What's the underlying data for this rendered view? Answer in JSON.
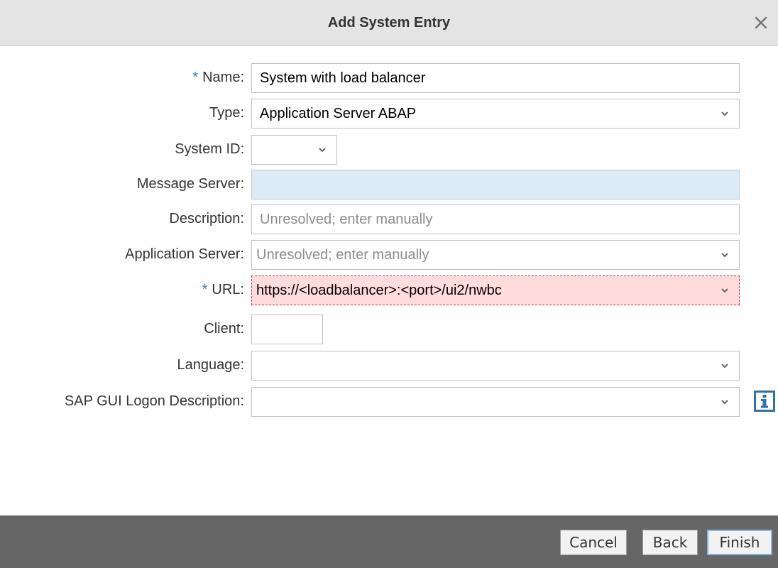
{
  "dialog": {
    "title": "Add System Entry"
  },
  "form": {
    "name": {
      "label": "Name:",
      "required_marker": "*",
      "value": "System with load balancer"
    },
    "type": {
      "label": "Type:",
      "value": "Application Server ABAP"
    },
    "system_id": {
      "label": "System ID:",
      "value": ""
    },
    "message_server": {
      "label": "Message Server:",
      "value": ""
    },
    "description": {
      "label": "Description:",
      "placeholder": "Unresolved; enter manually"
    },
    "application_server": {
      "label": "Application Server:",
      "placeholder": "Unresolved; enter manually"
    },
    "url": {
      "label": "URL:",
      "required_marker": "*",
      "value": "https://<loadbalancer>:<port>/ui2/nwbc"
    },
    "client": {
      "label": "Client:",
      "value": ""
    },
    "language": {
      "label": "Language:",
      "value": ""
    },
    "sap_gui_logon_description": {
      "label": "SAP GUI Logon Description:",
      "value": ""
    }
  },
  "footer": {
    "cancel_label": "Cancel",
    "back_label": "Back",
    "finish_label": "Finish"
  },
  "icons": {
    "close": "close-icon",
    "dropdown": "chevron-down-icon",
    "info": "info-icon"
  },
  "colors": {
    "required_marker": "#2f7fb6",
    "error_field_bg": "#ffdcdc",
    "error_field_border": "#cc3333",
    "readonly_field_bg": "#dcebf6",
    "footer_bg": "#666666",
    "primary_button_border": "#7fb6e3"
  }
}
